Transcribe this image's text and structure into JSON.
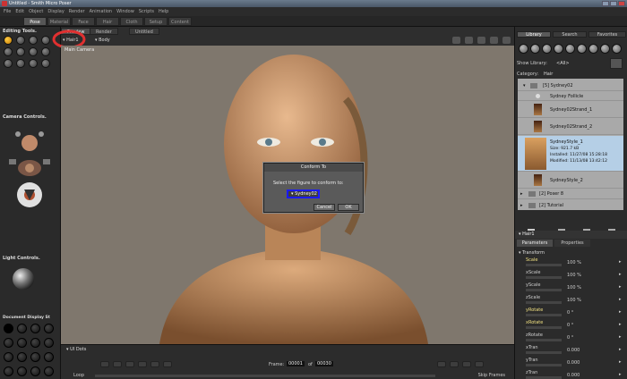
{
  "window": {
    "title": "Untitled - Smith Micro Poser"
  },
  "menu": [
    "File",
    "Edit",
    "Object",
    "Display",
    "Render",
    "Animation",
    "Window",
    "Scripts",
    "Help"
  ],
  "rooms": [
    {
      "label": "Pose",
      "active": true
    },
    {
      "label": "Material"
    },
    {
      "label": "Face"
    },
    {
      "label": "Hair"
    },
    {
      "label": "Cloth"
    },
    {
      "label": "Setup"
    },
    {
      "label": "Content"
    }
  ],
  "left": {
    "editing_title": "Editing Tools.",
    "camera_title": "Camera Controls.",
    "light_title": "Light Controls.",
    "doc_title": "Document Display St"
  },
  "document": {
    "tabs": [
      {
        "label": "Untitled"
      },
      {
        "label": "Preview",
        "active": true
      },
      {
        "label": "Render"
      }
    ],
    "actor_select": "Hair1",
    "figure_select": "Body",
    "camera_label": "Main Camera"
  },
  "dialog": {
    "title": "Conform To",
    "message": "Select the figure to conform to:",
    "selected": "Sydney02",
    "cancel": "Cancel",
    "ok": "OK"
  },
  "bottom": {
    "ui_dots": "UI Dots",
    "loop": "Loop",
    "frame_label": "Frame:",
    "frame": "00001",
    "of": "of",
    "total": "00030",
    "skip": "Skip Frames"
  },
  "library": {
    "tabs": [
      "Library",
      "Search",
      "Favorites"
    ],
    "show_label": "Show Library:",
    "show_value": "<All>",
    "category_label": "Category:",
    "category_value": "Hair",
    "items": [
      {
        "label": "[5] Sydney02"
      },
      {
        "label": "Sydney Follicle"
      },
      {
        "label": "Sydney02Strand_1"
      },
      {
        "label": "Sydney02Strand_2"
      },
      {
        "label": "SydneyStyle_1",
        "size": "Size: 921.7 kB",
        "installed": "Installed: 11/27/08 15:28:18",
        "modified": "Modified: 11/13/08 13:42:12"
      },
      {
        "label": "SydneyStyle_2"
      },
      {
        "label": "[2] Poser 8"
      },
      {
        "label": "[2] Tutorial"
      }
    ]
  },
  "parameters": {
    "actor": "Hair1",
    "tabs": [
      "Parameters",
      "Properties"
    ],
    "group": "Transform",
    "rows": [
      {
        "label": "Scale",
        "value": "100 %"
      },
      {
        "label": "xScale",
        "value": "100 %"
      },
      {
        "label": "yScale",
        "value": "100 %"
      },
      {
        "label": "zScale",
        "value": "100 %"
      },
      {
        "label": "yRotate",
        "value": "0 °"
      },
      {
        "label": "xRotate",
        "value": "0 °"
      },
      {
        "label": "zRotate",
        "value": "0 °"
      },
      {
        "label": "xTran",
        "value": "0.000"
      },
      {
        "label": "yTran",
        "value": "0.000"
      },
      {
        "label": "zTran",
        "value": "0.000"
      }
    ]
  },
  "colors": {
    "highlight": "#e03030",
    "dialog_focus": "#1a1aff",
    "viewport": "#7f776d"
  }
}
